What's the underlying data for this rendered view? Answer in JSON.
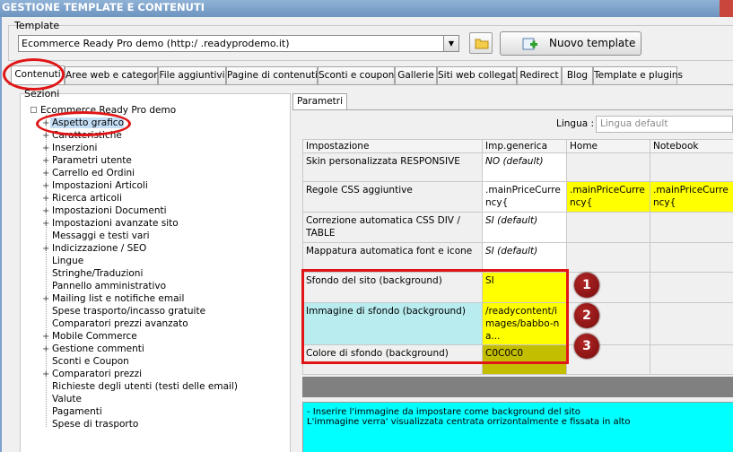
{
  "window": {
    "title": "GESTIONE TEMPLATE E CONTENUTI"
  },
  "template": {
    "group_label": "Template",
    "selected": "Ecommerce Ready Pro demo      (http:/       .readyprodemo.it)",
    "new_button": "Nuovo template"
  },
  "tabs": [
    {
      "label": "Contenuti",
      "active": true
    },
    {
      "label": "Aree web e categorie"
    },
    {
      "label": "File aggiuntivi"
    },
    {
      "label": "Pagine di contenuti"
    },
    {
      "label": "Sconti e coupon"
    },
    {
      "label": "Gallerie"
    },
    {
      "label": "Siti web collegati"
    },
    {
      "label": "Redirect"
    },
    {
      "label": "Blog"
    },
    {
      "label": "Template e plugins"
    }
  ],
  "sezioni": {
    "label": "Sezioni",
    "root": "Ecommerce Ready Pro demo",
    "items": [
      {
        "label": "Aspetto grafico",
        "expandable": true,
        "selected": true
      },
      {
        "label": "Caratteristiche",
        "expandable": true
      },
      {
        "label": "Inserzioni",
        "expandable": true
      },
      {
        "label": "Parametri utente",
        "expandable": true
      },
      {
        "label": "Carrello ed Ordini",
        "expandable": true
      },
      {
        "label": "Impostazioni Articoli",
        "expandable": true
      },
      {
        "label": "Ricerca articoli",
        "expandable": true
      },
      {
        "label": "Impostazioni Documenti",
        "expandable": true
      },
      {
        "label": "Impostazioni avanzate sito",
        "expandable": true
      },
      {
        "label": "Messaggi e testi vari",
        "expandable": false
      },
      {
        "label": "Indicizzazione / SEO",
        "expandable": true
      },
      {
        "label": "Lingue",
        "expandable": false
      },
      {
        "label": "Stringhe/Traduzioni",
        "expandable": false
      },
      {
        "label": "Pannello amministrativo",
        "expandable": false
      },
      {
        "label": "Mailing list e notifiche email",
        "expandable": true
      },
      {
        "label": "Spese trasporto/incasso gratuite",
        "expandable": false
      },
      {
        "label": "Comparatori prezzi avanzato",
        "expandable": false
      },
      {
        "label": "Mobile Commerce",
        "expandable": true
      },
      {
        "label": "Gestione commenti",
        "expandable": true
      },
      {
        "label": "Sconti e Coupon",
        "expandable": false
      },
      {
        "label": "Comparatori prezzi",
        "expandable": true
      },
      {
        "label": "Richieste degli utenti (testi delle email)",
        "expandable": false
      },
      {
        "label": "Valute",
        "expandable": false
      },
      {
        "label": "Pagamenti",
        "expandable": false
      },
      {
        "label": "Spese di trasporto",
        "expandable": false
      }
    ]
  },
  "parametri": {
    "tab_label": "Parametri",
    "lingua_label": "Lingua :",
    "lingua_placeholder": "Lingua default",
    "columns": [
      "Impostazione",
      "Imp.generica",
      "Home",
      "Notebook"
    ],
    "rows": [
      {
        "label": "Skin personalizzata RESPONSIVE",
        "generic": "NO (default)",
        "home": "",
        "notebook": ""
      },
      {
        "label": "Regole CSS aggiuntive",
        "generic": ".mainPriceCurrency{",
        "home": ".mainPriceCurrency{",
        "notebook": ".mainPriceCurrency{"
      },
      {
        "label": "Correzione automatica CSS DIV / TABLE",
        "generic": "SI (default)",
        "home": "",
        "notebook": ""
      },
      {
        "label": "Mappatura automatica font e icone",
        "generic": "SI (default)",
        "home": "",
        "notebook": ""
      },
      {
        "label": "Sfondo del sito (background)",
        "generic": "SI",
        "home": "",
        "notebook": ""
      },
      {
        "label": "Immagine di sfondo (background)",
        "generic": "/readycontent/images/babbo-na...",
        "home": "",
        "notebook": ""
      },
      {
        "label": "Colore di sfondo (background)",
        "generic": "C0C0C0",
        "home": "",
        "notebook": ""
      }
    ],
    "help_lines": [
      "- Inserire l'immagine da impostare come background del sito",
      "L'immagine verra' visualizzata centrata orrizontalmente e fissata in alto"
    ]
  },
  "annotations": {
    "badges": [
      "1",
      "2",
      "3"
    ]
  },
  "colors": {
    "highlight_yellow": "#ffff00",
    "highlight_olive": "#c4be00",
    "highlight_cyan": "#b8ecef",
    "annotation_red": "#e01616"
  }
}
